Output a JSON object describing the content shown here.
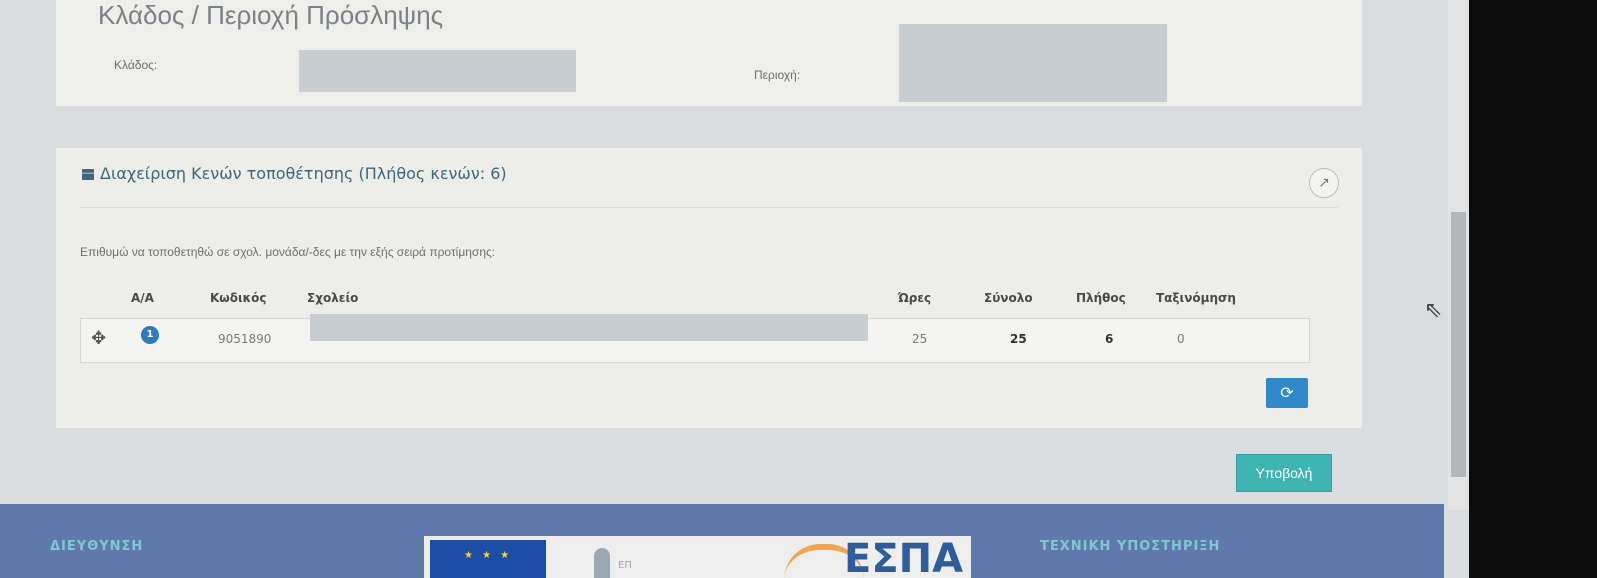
{
  "section": {
    "heading": "Κλάδος / Περιοχή Πρόσληψης",
    "branch_label": "Κλάδος:",
    "area_label": "Περιοχή:"
  },
  "panel": {
    "title": "Διαχείριση Κενών τοποθέτησης (Πλήθος κενών: 6)",
    "expand_icon": "↗",
    "instructions": "Επιθυμώ να τοποθετηθώ σε σχολ. μονάδα/-δες με την εξής σειρά προτίμησης:"
  },
  "table": {
    "headers": {
      "aa": "Α/Α",
      "code": "Κωδικός",
      "school": "Σχολείο",
      "hours": "Ώρες",
      "total": "Σύνολο",
      "count": "Πλήθος",
      "rank": "Ταξινόμηση"
    },
    "rows": [
      {
        "move_icon": "✥",
        "aa": "1",
        "code": "9051890",
        "hours": "25",
        "total": "25",
        "count": "6",
        "rank": "0"
      }
    ]
  },
  "buttons": {
    "refresh_icon": "⟳",
    "submit": "Υποβολή"
  },
  "footer": {
    "left": "ΔΙΕΥΘΥΝΣΗ",
    "right": "ΤΕΧΝΙΚΗ ΥΠΟΣΤΗΡΙΞΗ",
    "espa_logo": "ΕΣΠΑ",
    "eu_stars": "★ ★ ★",
    "ep_text": "ΕΠ"
  },
  "cursor_icon": "⇖",
  "colors": {
    "panel_title": "#3f6678",
    "badge": "#2a7bbf",
    "refresh_button": "#2f88c8",
    "submit_button": "#3eb5b2",
    "footer_bg": "#6079ad"
  }
}
